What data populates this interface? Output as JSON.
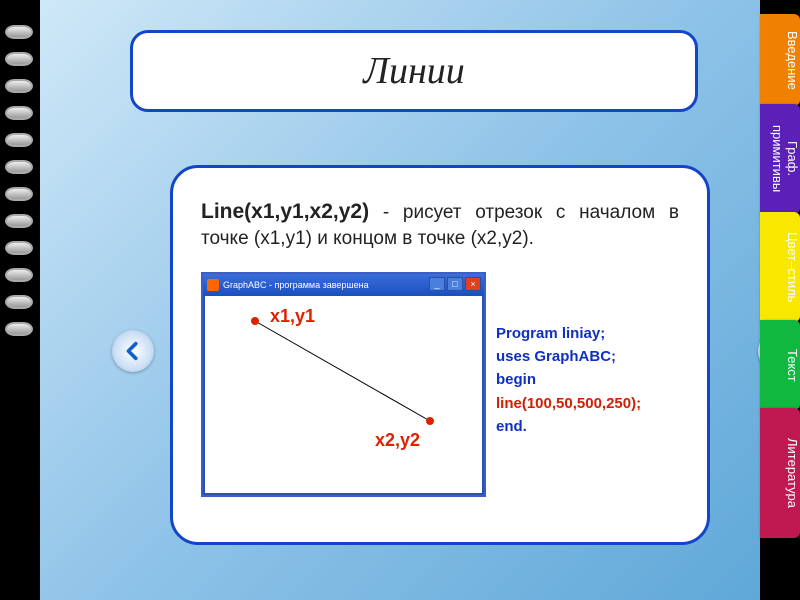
{
  "title": "Линии",
  "description_bold": "Line(x1,y1,x2,y2)",
  "description_rest": " - рисует отрезок с началом в точке (x1,y1) и концом в точке (x2,y2).",
  "window": {
    "title": "GraphABC - программа завершена",
    "label1": "x1,y1",
    "label2": "x2,y2"
  },
  "code": {
    "l1": "Program liniay;",
    "l2": "uses GraphABC;",
    "l3": "begin",
    "l4": "line(100,50,500,250);",
    "l5": "end."
  },
  "tabs": {
    "t1": "Введение",
    "t2": "Граф. примитивы",
    "t3": "Цвет–стиль",
    "t4": "Текст",
    "t5": "Литература"
  }
}
